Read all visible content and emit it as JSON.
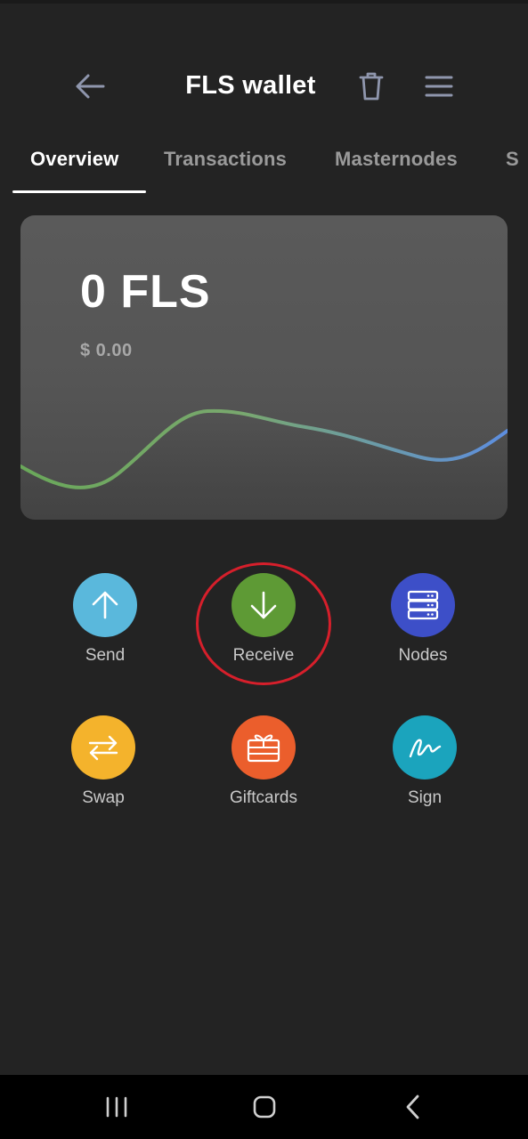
{
  "header": {
    "title": "FLS wallet",
    "back_icon": "arrow-left-icon",
    "trash_icon": "trash-icon",
    "menu_icon": "hamburger-menu-icon"
  },
  "tabs": [
    {
      "label": "Overview",
      "active": true
    },
    {
      "label": "Transactions",
      "active": false
    },
    {
      "label": "Masternodes",
      "active": false
    },
    {
      "label": "S",
      "active": false
    }
  ],
  "balance_card": {
    "amount": "0 FLS",
    "fiat_value": "$ 0.00",
    "line_gradient": [
      "#6aa85a",
      "#5d8ee0"
    ]
  },
  "actions": [
    {
      "label": "Send",
      "icon": "arrow-up-icon",
      "color": "#5ab8dc"
    },
    {
      "label": "Receive",
      "icon": "arrow-down-icon",
      "color": "#5e9a35"
    },
    {
      "label": "Nodes",
      "icon": "server-icon",
      "color": "#3d4fc8"
    },
    {
      "label": "Swap",
      "icon": "swap-arrows-icon",
      "color": "#f4b32c"
    },
    {
      "label": "Giftcards",
      "icon": "gift-icon",
      "color": "#eb5e2c"
    },
    {
      "label": "Sign",
      "icon": "signature-icon",
      "color": "#1ba4bd"
    }
  ],
  "highlight": {
    "target": "Receive",
    "color": "#d61f2b"
  },
  "system_nav": [
    {
      "icon": "recent-apps-icon"
    },
    {
      "icon": "home-icon"
    },
    {
      "icon": "back-chevron-icon"
    }
  ]
}
